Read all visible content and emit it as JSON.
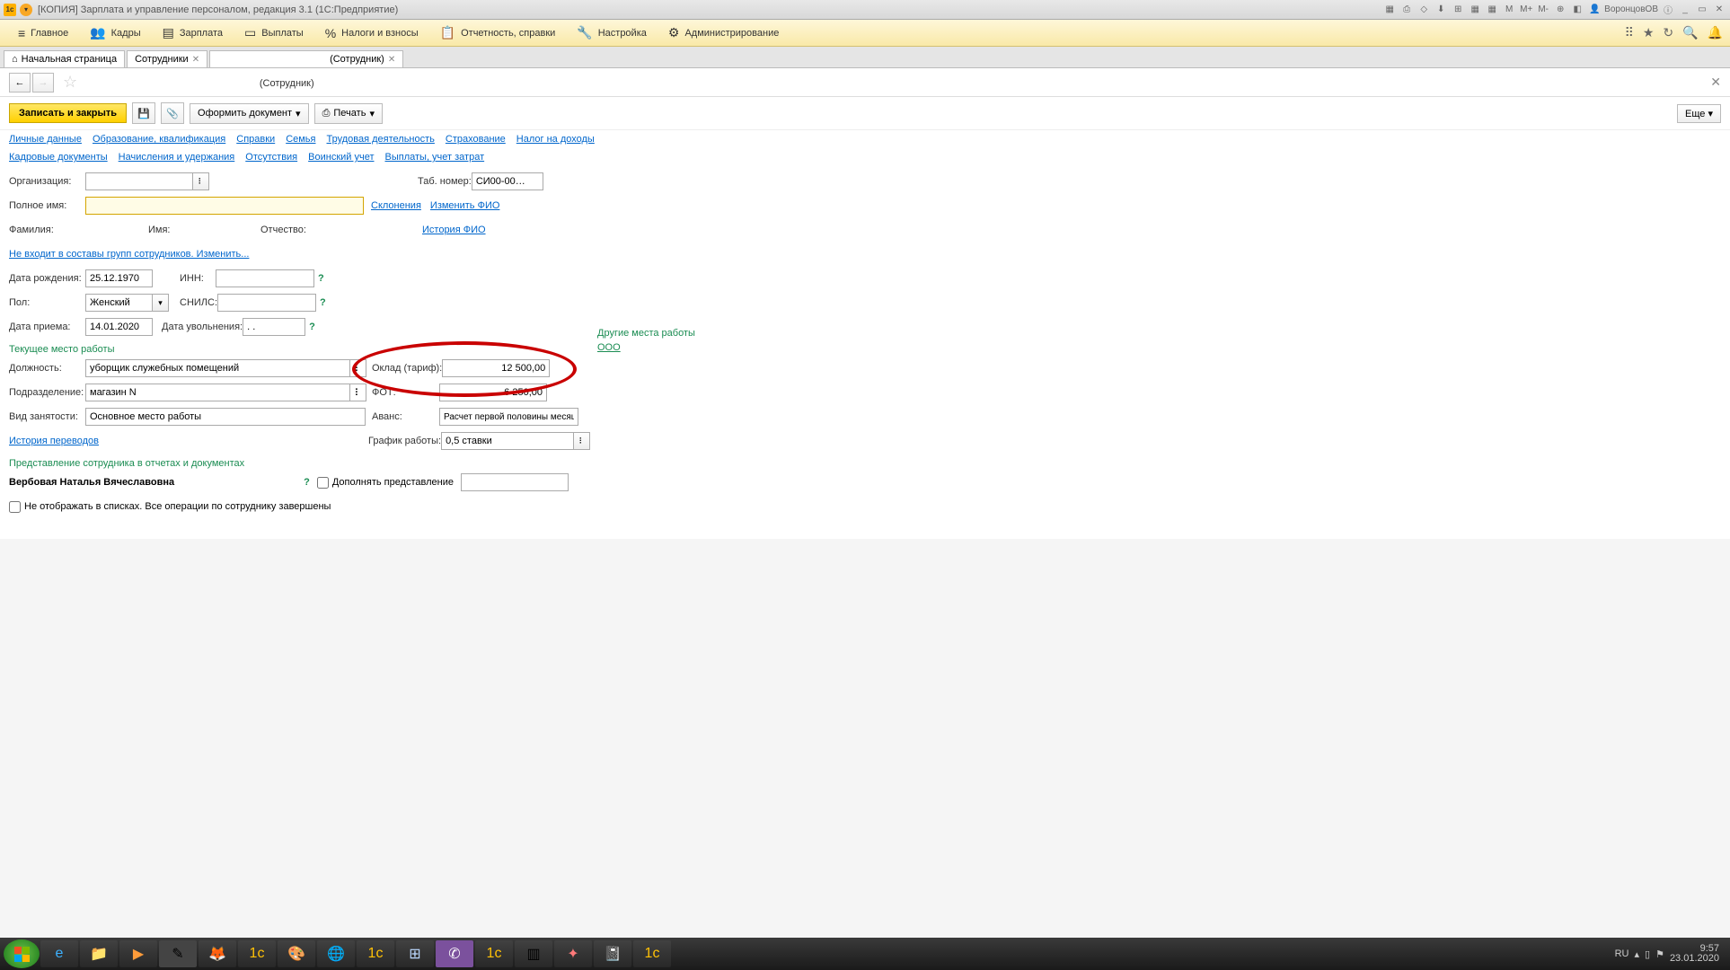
{
  "titlebar": {
    "app_title": "[КОПИЯ] Зарплата и управление персоналом, редакция 3.1  (1С:Предприятие)",
    "user": "ВоронцовОВ"
  },
  "menu": {
    "items": [
      "Главное",
      "Кадры",
      "Зарплата",
      "Выплаты",
      "Налоги и взносы",
      "Отчетность, справки",
      "Настройка",
      "Администрирование"
    ]
  },
  "tabs": {
    "home": "Начальная страница",
    "t1": "Сотрудники",
    "t2_suffix": "(Сотрудник)"
  },
  "page": {
    "title_suffix": "(Сотрудник)"
  },
  "toolbar": {
    "save_close": "Записать и закрыть",
    "format_doc": "Оформить документ",
    "print": "Печать",
    "more": "Еще"
  },
  "links": {
    "row1": [
      "Личные данные",
      "Образование, квалификация",
      "Справки",
      "Семья",
      "Трудовая деятельность",
      "Страхование",
      "Налог на доходы"
    ],
    "row2": [
      "Кадровые документы",
      "Начисления и удержания",
      "Отсутствия",
      "Воинский учет",
      "Выплаты, учет затрат"
    ]
  },
  "form": {
    "org_lbl": "Организация:",
    "tabno_lbl": "Таб. номер:",
    "tabno_val": "СИ00-00…",
    "fullname_lbl": "Полное имя:",
    "declension": "Склонения",
    "change_fio": "Изменить ФИО",
    "lastname_lbl": "Фамилия:",
    "firstname_lbl": "Имя:",
    "patronymic_lbl": "Отчество:",
    "history_fio": "История ФИО",
    "not_in_groups": "Не входит в составы групп сотрудников. Изменить...",
    "dob_lbl": "Дата рождения:",
    "dob_val": "25.12.1970",
    "inn_lbl": "ИНН:",
    "gender_lbl": "Пол:",
    "gender_val": "Женский",
    "snils_lbl": "СНИЛС:",
    "hire_lbl": "Дата приема:",
    "hire_val": "14.01.2020",
    "fire_lbl": "Дата увольнения:",
    "fire_val": ". .",
    "current_job": "Текущее место работы",
    "position_lbl": "Должность:",
    "position_val": "уборщик служебных помещений",
    "dept_lbl": "Подразделение:",
    "dept_val": "магазин N",
    "employment_lbl": "Вид занятости:",
    "employment_val": "Основное место работы",
    "salary_lbl": "Оклад (тариф):",
    "salary_val": "12 500,00",
    "fot_lbl": "ФОТ:",
    "fot_val": "6 250,00",
    "advance_lbl": "Аванс:",
    "advance_val": "Расчет первой половины месяца",
    "schedule_lbl": "График работы:",
    "schedule_val": "0,5 ставки",
    "other_jobs": "Другие места работы",
    "other_link": "ООО",
    "transfer_history": "История переводов",
    "representation": "Представление сотрудника в отчетах и документах",
    "rep_name": "Вербовая Наталья Вячеславовна",
    "supplement_lbl": "Дополнять представление",
    "hide_lbl": "Не отображать в списках. Все операции по сотруднику завершены"
  },
  "tray": {
    "lang": "RU",
    "time": "9:57",
    "date": "23.01.2020"
  }
}
